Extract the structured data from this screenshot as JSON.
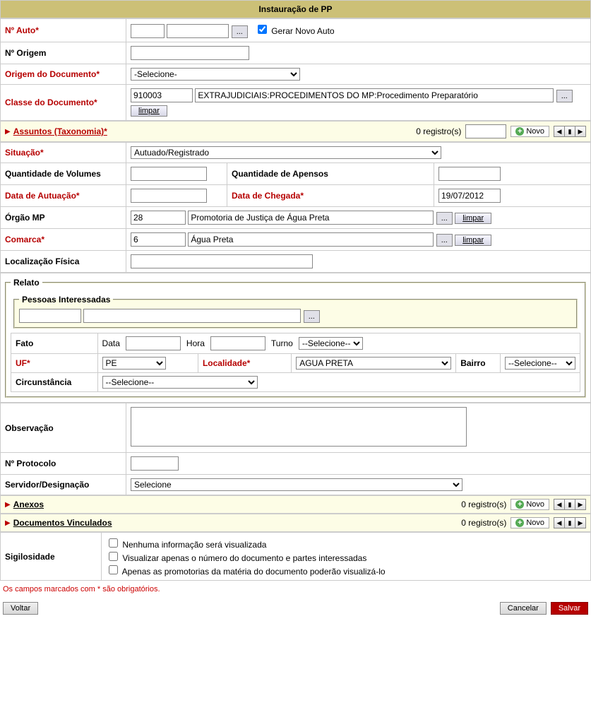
{
  "title": "Instauração de PP",
  "labels": {
    "n_auto": "Nº Auto*",
    "gerar_novo_auto": "Gerar Novo Auto",
    "n_origem": "Nº Origem",
    "origem_doc": "Origem do Documento*",
    "classe_doc": "Classe do Documento*",
    "limpar": "limpar",
    "situacao": "Situação*",
    "qtd_volumes": "Quantidade de Volumes",
    "qtd_apensos": "Quantidade de Apensos",
    "data_autuacao": "Data de Autuação*",
    "data_chegada": "Data de Chegada*",
    "orgao_mp": "Órgão MP",
    "comarca": "Comarca*",
    "localizacao": "Localização Física",
    "relato": "Relato",
    "pessoas": "Pessoas Interessadas",
    "fato": "Fato",
    "data": "Data",
    "hora": "Hora",
    "turno": "Turno",
    "uf": "UF*",
    "localidade": "Localidade*",
    "bairro": "Bairro",
    "circunstancia": "Circunstância",
    "observacao": "Observação",
    "protocolo": "Nº Protocolo",
    "servidor": "Servidor/Designação",
    "sigilosidade": "Sigilosidade",
    "sigil_1": "Nenhuma informação será visualizada",
    "sigil_2": "Visualizar apenas o número do documento e partes interessadas",
    "sigil_3": "Apenas as promotorias da matéria do documento poderão visualizá-lo",
    "footnote": "Os campos marcados com * são obrigatórios.",
    "voltar": "Voltar",
    "cancelar": "Cancelar",
    "salvar": "Salvar",
    "novo": "Novo",
    "registros": "0 registro(s)",
    "lookup": "..."
  },
  "bands": {
    "assuntos": "Assuntos (Taxonomia)*",
    "anexos": "Anexos",
    "docs_vinc": "Documentos Vinculados"
  },
  "values": {
    "origem_sel": "-Selecione-",
    "classe_code": "910003",
    "classe_desc": "EXTRAJUDICIAIS:PROCEDIMENTOS DO MP:Procedimento Preparatório",
    "situacao_sel": "Autuado/Registrado",
    "data_chegada": "19/07/2012",
    "orgao_code": "28",
    "orgao_desc": "Promotoria de Justiça de Água Preta",
    "comarca_code": "6",
    "comarca_desc": "Água Preta",
    "turno_sel": "--Selecione--",
    "uf_sel": "PE",
    "localidade_sel": "AGUA PRETA",
    "bairro_sel": "--Selecione--",
    "circunstancia_sel": "--Selecione--",
    "servidor_sel": "Selecione"
  }
}
